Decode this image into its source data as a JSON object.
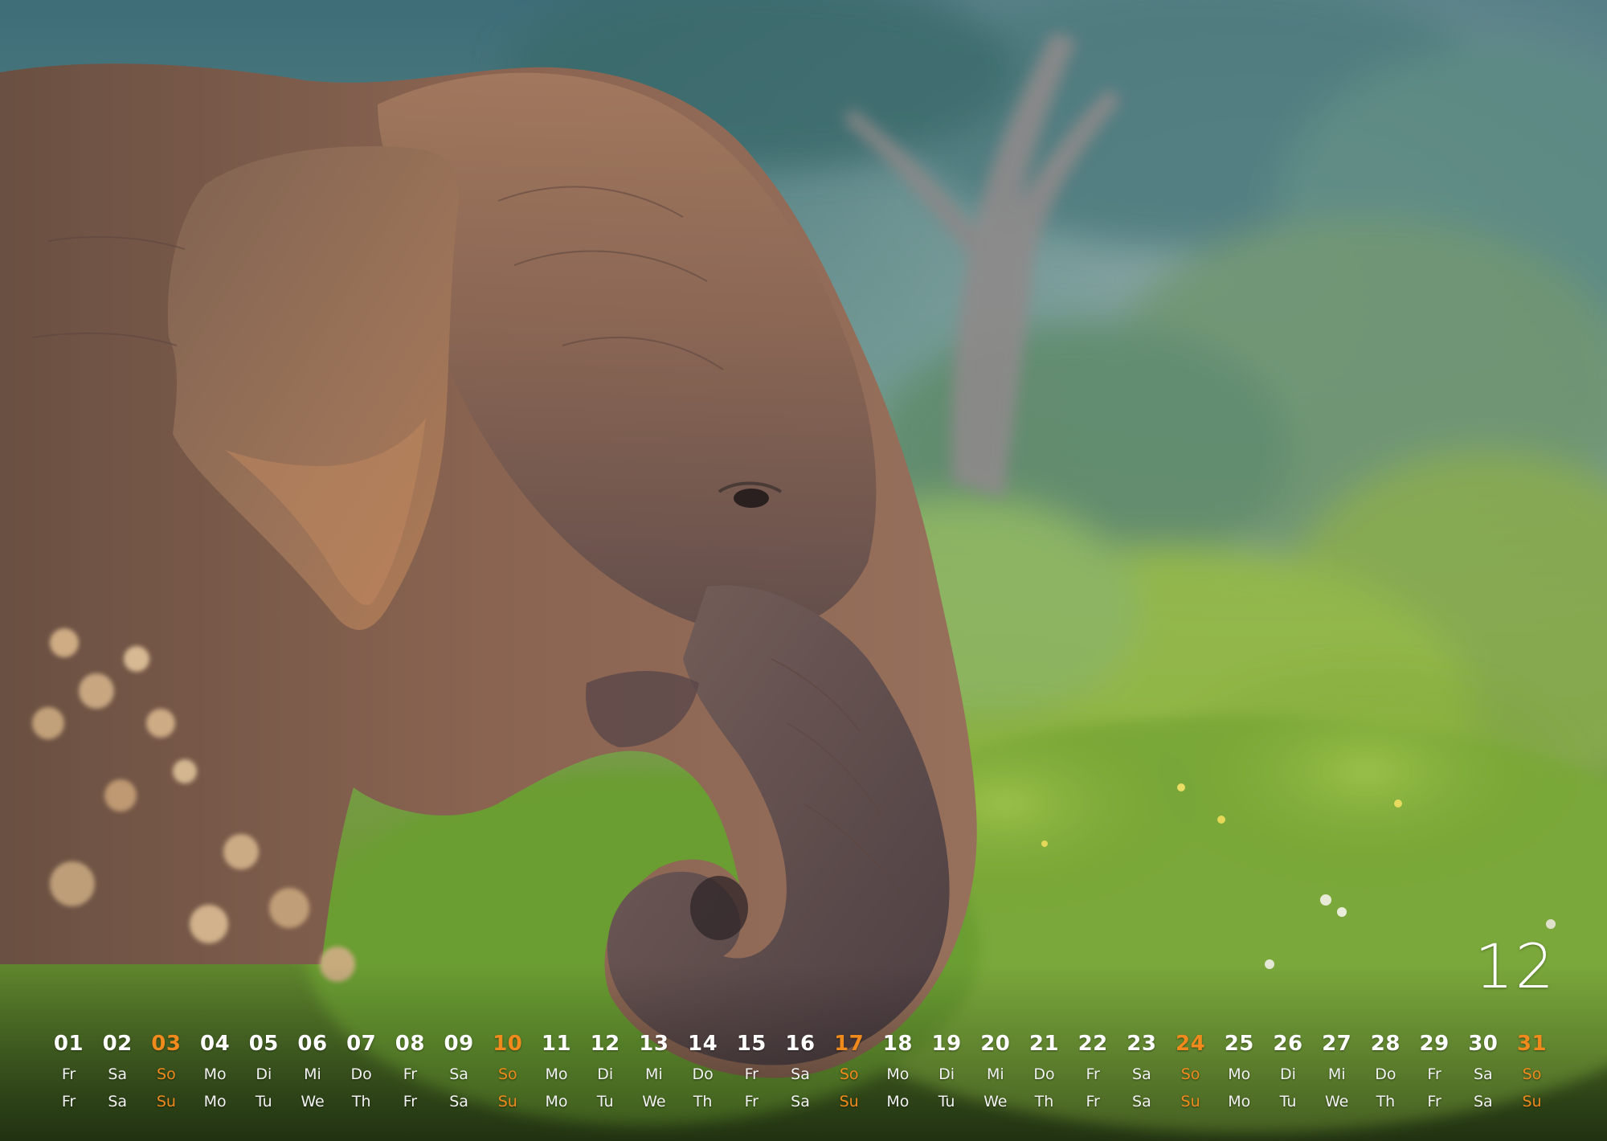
{
  "photo": {
    "subject": "elephant"
  },
  "calendar": {
    "month_number": "12",
    "accent_color": "#f08a1c",
    "days": [
      {
        "num": "01",
        "de": "Fr",
        "en": "Fr",
        "sunday": false
      },
      {
        "num": "02",
        "de": "Sa",
        "en": "Sa",
        "sunday": false
      },
      {
        "num": "03",
        "de": "So",
        "en": "Su",
        "sunday": true
      },
      {
        "num": "04",
        "de": "Mo",
        "en": "Mo",
        "sunday": false
      },
      {
        "num": "05",
        "de": "Di",
        "en": "Tu",
        "sunday": false
      },
      {
        "num": "06",
        "de": "Mi",
        "en": "We",
        "sunday": false
      },
      {
        "num": "07",
        "de": "Do",
        "en": "Th",
        "sunday": false
      },
      {
        "num": "08",
        "de": "Fr",
        "en": "Fr",
        "sunday": false
      },
      {
        "num": "09",
        "de": "Sa",
        "en": "Sa",
        "sunday": false
      },
      {
        "num": "10",
        "de": "So",
        "en": "Su",
        "sunday": true
      },
      {
        "num": "11",
        "de": "Mo",
        "en": "Mo",
        "sunday": false
      },
      {
        "num": "12",
        "de": "Di",
        "en": "Tu",
        "sunday": false
      },
      {
        "num": "13",
        "de": "Mi",
        "en": "We",
        "sunday": false
      },
      {
        "num": "14",
        "de": "Do",
        "en": "Th",
        "sunday": false
      },
      {
        "num": "15",
        "de": "Fr",
        "en": "Fr",
        "sunday": false
      },
      {
        "num": "16",
        "de": "Sa",
        "en": "Sa",
        "sunday": false
      },
      {
        "num": "17",
        "de": "So",
        "en": "Su",
        "sunday": true
      },
      {
        "num": "18",
        "de": "Mo",
        "en": "Mo",
        "sunday": false
      },
      {
        "num": "19",
        "de": "Di",
        "en": "Tu",
        "sunday": false
      },
      {
        "num": "20",
        "de": "Mi",
        "en": "We",
        "sunday": false
      },
      {
        "num": "21",
        "de": "Do",
        "en": "Th",
        "sunday": false
      },
      {
        "num": "22",
        "de": "Fr",
        "en": "Fr",
        "sunday": false
      },
      {
        "num": "23",
        "de": "Sa",
        "en": "Sa",
        "sunday": false
      },
      {
        "num": "24",
        "de": "So",
        "en": "Su",
        "sunday": true
      },
      {
        "num": "25",
        "de": "Mo",
        "en": "Mo",
        "sunday": false
      },
      {
        "num": "26",
        "de": "Di",
        "en": "Tu",
        "sunday": false
      },
      {
        "num": "27",
        "de": "Mi",
        "en": "We",
        "sunday": false
      },
      {
        "num": "28",
        "de": "Do",
        "en": "Th",
        "sunday": false
      },
      {
        "num": "29",
        "de": "Fr",
        "en": "Fr",
        "sunday": false
      },
      {
        "num": "30",
        "de": "Sa",
        "en": "Sa",
        "sunday": false
      },
      {
        "num": "31",
        "de": "So",
        "en": "Su",
        "sunday": true
      }
    ]
  }
}
